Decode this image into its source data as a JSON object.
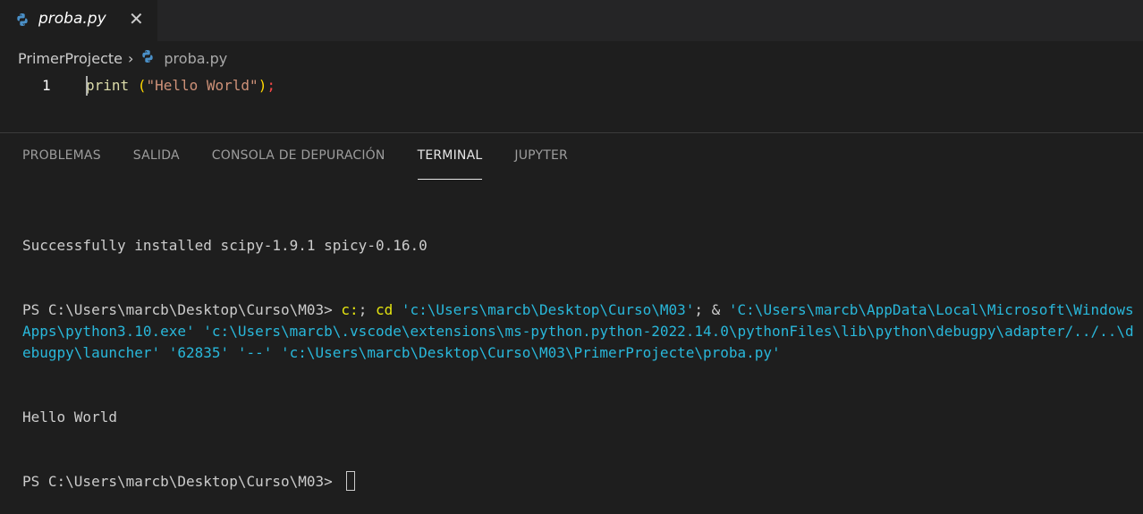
{
  "tab": {
    "title": "proba.py",
    "close_icon": "close-icon"
  },
  "breadcrumb": {
    "folder": "PrimerProjecte",
    "separator": "›",
    "file": "proba.py"
  },
  "editor": {
    "line_number": "1",
    "code": {
      "fn": "print",
      "space": " ",
      "open": "(",
      "string": "\"Hello World\"",
      "close": ")",
      "semi": ";"
    }
  },
  "panel": {
    "tabs": [
      {
        "label": "PROBLEMAS"
      },
      {
        "label": "SALIDA"
      },
      {
        "label": "CONSOLA DE DEPURACIÓN"
      },
      {
        "label": "TERMINAL",
        "active": true
      },
      {
        "label": "JUPYTER"
      }
    ]
  },
  "terminal": {
    "line1": "Successfully installed scipy-1.9.1 spicy-0.16.0",
    "prompt1": "PS C:\\Users\\marcb\\Desktop\\Curso\\M03> ",
    "cmd_c": "c:",
    "sep1": "; ",
    "cmd_cd": "cd",
    "cd_arg": " 'c:\\Users\\marcb\\Desktop\\Curso\\M03'",
    "sep2": "; & ",
    "exe": "'C:\\Users\\marcb\\AppData\\Local\\Microsoft\\WindowsApps\\python3.10.exe' 'c:\\Users\\marcb\\.vscode\\extensions\\ms-python.python-2022.14.0\\pythonFiles\\lib\\python\\debugpy\\adapter/../..\\debugpy\\launcher' '62835' '--' 'c:\\Users\\marcb\\Desktop\\Curso\\M03\\PrimerProjecte\\proba.py'",
    "output": "Hello World",
    "prompt2": "PS C:\\Users\\marcb\\Desktop\\Curso\\M03> "
  },
  "colors": {
    "background": "#1e1e1e",
    "terminal_string": "#29b8db",
    "terminal_cmd": "#e5e510"
  }
}
